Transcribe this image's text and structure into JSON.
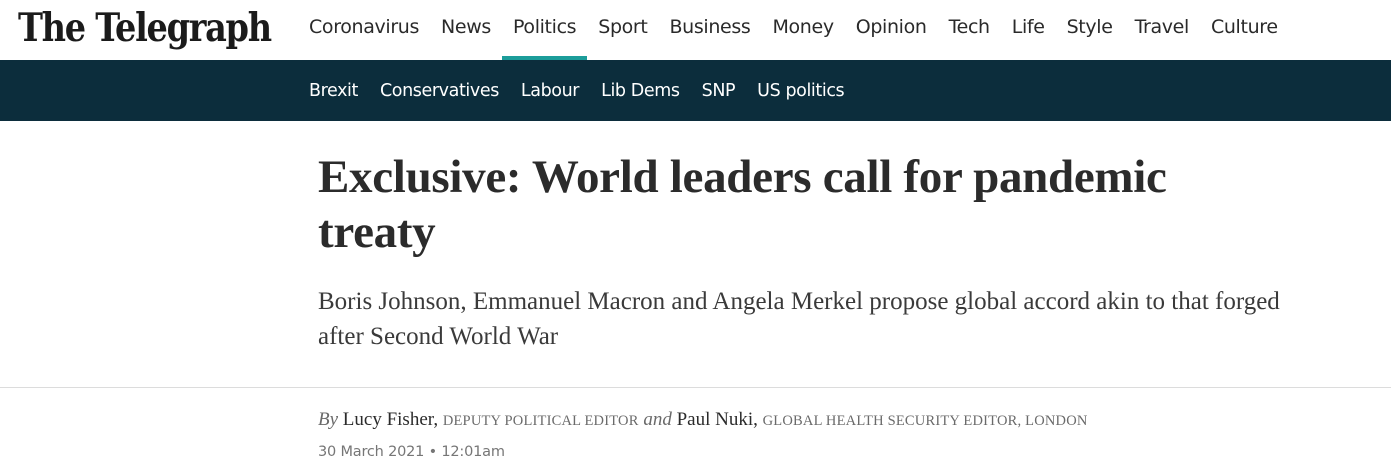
{
  "masthead": {
    "logo_text": "The Telegraph"
  },
  "primary_nav": [
    {
      "label": "Coronavirus",
      "active": false
    },
    {
      "label": "News",
      "active": false
    },
    {
      "label": "Politics",
      "active": true
    },
    {
      "label": "Sport",
      "active": false
    },
    {
      "label": "Business",
      "active": false
    },
    {
      "label": "Money",
      "active": false
    },
    {
      "label": "Opinion",
      "active": false
    },
    {
      "label": "Tech",
      "active": false
    },
    {
      "label": "Life",
      "active": false
    },
    {
      "label": "Style",
      "active": false
    },
    {
      "label": "Travel",
      "active": false
    },
    {
      "label": "Culture",
      "active": false
    }
  ],
  "sub_nav": [
    {
      "label": "Brexit"
    },
    {
      "label": "Conservatives"
    },
    {
      "label": "Labour"
    },
    {
      "label": "Lib Dems"
    },
    {
      "label": "SNP"
    },
    {
      "label": "US politics"
    }
  ],
  "article": {
    "headline": "Exclusive: World leaders call for pandemic treaty",
    "standfirst": "Boris Johnson, Emmanuel Macron and Angela Merkel propose global accord akin to that forged after Second World War",
    "byline": {
      "by": "By",
      "author1": "Lucy Fisher,",
      "role1": "DEPUTY POLITICAL EDITOR",
      "and": "and",
      "author2": "Paul Nuki,",
      "role2": "GLOBAL HEALTH SECURITY EDITOR, LONDON"
    },
    "date": "30 March 2021",
    "separator": "•",
    "time": "12:01am"
  },
  "colors": {
    "accent": "#1c9d9a",
    "subnav_bg": "#0c2d3c"
  }
}
